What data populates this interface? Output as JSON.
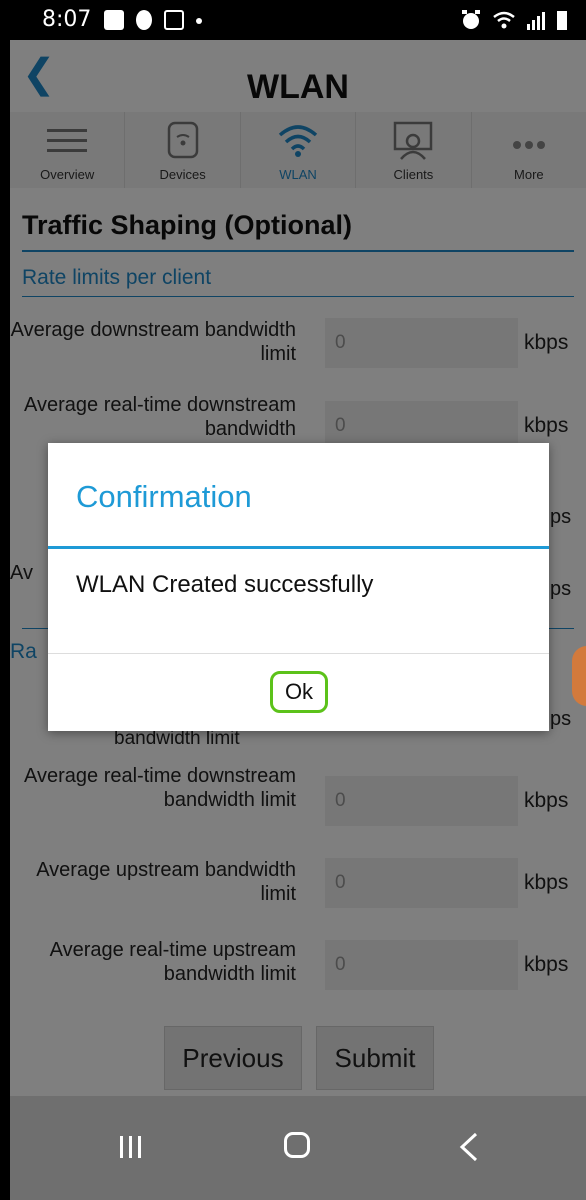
{
  "status_bar": {
    "time": "8:07"
  },
  "app_bar": {
    "title": "WLAN"
  },
  "nav": [
    {
      "label": "Overview",
      "icon": "hamburger-icon"
    },
    {
      "label": "Devices",
      "icon": "devices-icon"
    },
    {
      "label": "WLAN",
      "icon": "wifi-icon",
      "active": true
    },
    {
      "label": "Clients",
      "icon": "clients-icon"
    },
    {
      "label": "More",
      "icon": "more-dots-icon"
    }
  ],
  "content": {
    "section_title": "Traffic Shaping (Optional)",
    "rate_per_client": "Rate limits per client",
    "rows_top": [
      {
        "label": "Average downstream bandwidth limit",
        "value": "0",
        "unit": "kbps"
      },
      {
        "label": "Average real-time downstream bandwidth",
        "value": "0",
        "unit": "kbps"
      }
    ],
    "rows_bottom": [
      {
        "label": "Average real-time downstream bandwidth limit",
        "value": "0",
        "unit": "kbps"
      },
      {
        "label": "Average upstream bandwidth limit",
        "value": "0",
        "unit": "kbps"
      },
      {
        "label": "Average real-time upstream bandwidth limit",
        "value": "0",
        "unit": "kbps"
      }
    ],
    "peek_left": "Av",
    "peek_right": "ps",
    "peek_left2": "Ra",
    "peek_bottom_label": "bandwidth limit",
    "buttons": {
      "previous": "Previous",
      "submit": "Submit"
    }
  },
  "dialog": {
    "title": "Confirmation",
    "message": "WLAN Created successfully",
    "ok_label": "Ok"
  },
  "colors": {
    "accent": "#1e88c8",
    "ok_highlight": "#5cc21a"
  }
}
